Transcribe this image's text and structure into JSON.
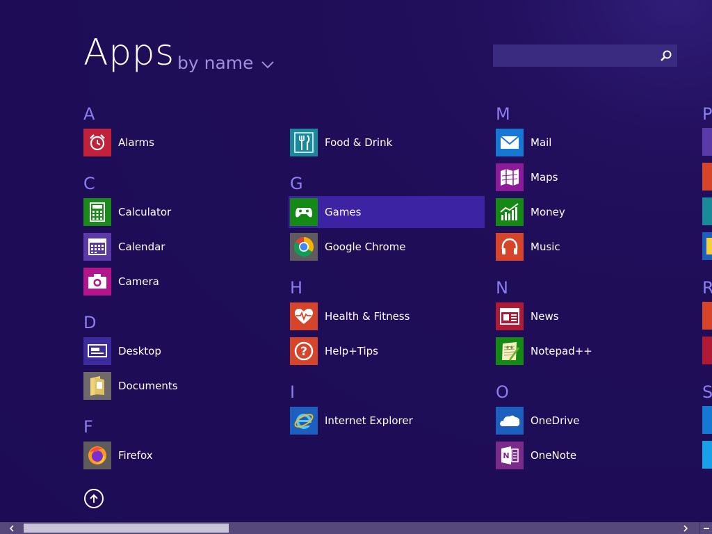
{
  "header": {
    "title": "Apps",
    "sort_label": "by name",
    "search_placeholder": ""
  },
  "groups": [
    {
      "letter": "A",
      "items": [
        "Alarms"
      ]
    },
    {
      "letter": "C",
      "items": [
        "Calculator",
        "Calendar",
        "Camera"
      ]
    },
    {
      "letter": "D",
      "items": [
        "Desktop",
        "Documents"
      ]
    },
    {
      "letter": "F",
      "items": [
        "Firefox",
        "Food & Drink"
      ]
    },
    {
      "letter": "G",
      "items": [
        "Games",
        "Google Chrome"
      ]
    },
    {
      "letter": "H",
      "items": [
        "Health & Fitness",
        "Help+Tips"
      ]
    },
    {
      "letter": "I",
      "items": [
        "Internet Explorer"
      ]
    },
    {
      "letter": "M",
      "items": [
        "Mail",
        "Maps",
        "Money",
        "Music"
      ]
    },
    {
      "letter": "N",
      "items": [
        "News",
        "Notepad++"
      ]
    },
    {
      "letter": "O",
      "items": [
        "OneDrive",
        "OneNote"
      ]
    },
    {
      "letter": "P",
      "items": []
    },
    {
      "letter": "R",
      "items": []
    },
    {
      "letter": "S",
      "items": []
    }
  ],
  "selected_app": "Games",
  "colors": {
    "background": "#1f0d58",
    "accent_letter": "#8c7ef0",
    "selection": "#3b23a3",
    "alarms": "#c1213a",
    "calculator": "#1a8a1a",
    "calendar": "#5a3aa8",
    "camera": "#b4148c",
    "desktop": "#3b2b9e",
    "documents": "#6e6a6a",
    "firefox": "#5d5b5b",
    "food": "#1a8a9a",
    "games": "#148a14",
    "chrome": "#5d5b5b",
    "health": "#d6452a",
    "help": "#d6452a",
    "ie": "#1c5fbf",
    "mail": "#1478d4",
    "maps": "#8c1a9a",
    "money": "#148a14",
    "music": "#d6452a",
    "news": "#b01a34",
    "notepad": "#148a14",
    "onedrive": "#1c5fbf",
    "onenote": "#7a2a8a"
  },
  "icons": {
    "Alarms": "alarm-clock-icon",
    "Calculator": "calculator-icon",
    "Calendar": "calendar-icon",
    "Camera": "camera-icon",
    "Desktop": "desktop-icon",
    "Documents": "folder-icon",
    "Firefox": "firefox-icon",
    "Food & Drink": "fork-knife-icon",
    "Games": "gamepad-icon",
    "Google Chrome": "chrome-icon",
    "Health & Fitness": "heart-pulse-icon",
    "Help+Tips": "question-icon",
    "Internet Explorer": "internet-explorer-icon",
    "Mail": "mail-icon",
    "Maps": "map-icon",
    "Money": "chart-icon",
    "Music": "headphones-icon",
    "News": "newspaper-icon",
    "Notepad++": "notepad-icon",
    "OneDrive": "cloud-icon",
    "OneNote": "onenote-icon"
  }
}
